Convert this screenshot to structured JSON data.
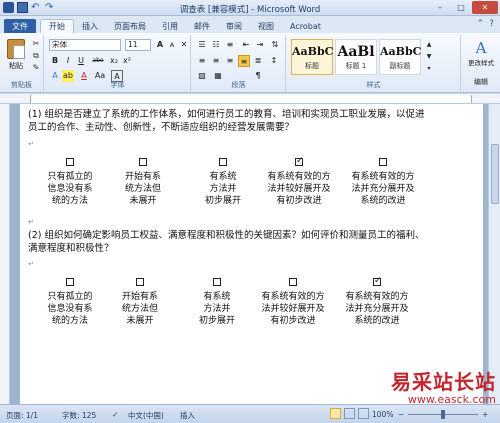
{
  "window": {
    "title": "调查表 [兼容模式] - Microsoft Word",
    "controls": {
      "minimize": "–",
      "maximize": "□",
      "close": "✕"
    }
  },
  "tabs": [
    "文件",
    "开始",
    "插入",
    "页面布局",
    "引用",
    "邮件",
    "审阅",
    "视图",
    "Acrobat"
  ],
  "ribbon": {
    "clipboard": {
      "paste_label": "粘贴",
      "group_label": "剪贴板"
    },
    "font": {
      "name": "宋体",
      "size": "11",
      "group_label": "字体",
      "buttons": [
        "B",
        "I",
        "U",
        "abe",
        "x₂",
        "x²",
        "A",
        "A",
        "Aa",
        "A"
      ]
    },
    "paragraph": {
      "group_label": "段落"
    },
    "styles": {
      "group_label": "样式",
      "items": [
        {
          "sample": "AaBbC",
          "name": "标题"
        },
        {
          "sample": "AaBl",
          "name": "标题 1"
        },
        {
          "sample": "AaBbC",
          "name": "副标题"
        }
      ],
      "change_styles": "更改样式",
      "edit_label": "编辑"
    }
  },
  "document": {
    "q1": "(1) 组织是否建立了系统的工作体系，如何进行员工的教育、培训和实现员工职业发展，以促进员工的合作、主动性、创新性，不断适应组织的经营发展需要？",
    "q1_options": [
      {
        "lines": [
          "只有孤立的",
          "信息没有系",
          "统的方法"
        ],
        "checked": false
      },
      {
        "lines": [
          "开始有系",
          "统方法但",
          "未展开"
        ],
        "checked": false
      },
      {
        "lines": [
          "有系统",
          "方法并",
          "初步展开"
        ],
        "checked": false
      },
      {
        "lines": [
          "有系统有效的方",
          "法并较好展开及",
          "有初步改进"
        ],
        "checked": true
      },
      {
        "lines": [
          "有系统有效的方",
          "法并充分展开及",
          "系统的改进"
        ],
        "checked": false
      }
    ],
    "q2": "(2) 组织如何确定影响员工权益、满意程度和积极性的关键因素？如何评价和测量员工的福利、满意程度和积极性？",
    "q2_options": [
      {
        "lines": [
          "只有孤立的",
          "信息没有系",
          "统的方法"
        ],
        "checked": false
      },
      {
        "lines": [
          "开始有系",
          "统方法但",
          "未展开"
        ],
        "checked": false
      },
      {
        "lines": [
          "有系统",
          "方法并",
          "初步展开"
        ],
        "checked": false
      },
      {
        "lines": [
          "有系统有效的方",
          "法并较好展开及",
          "有初步改进"
        ],
        "checked": false
      },
      {
        "lines": [
          "有系统有效的方",
          "法并充分展开及",
          "系统的改进"
        ],
        "checked": true
      }
    ]
  },
  "statusbar": {
    "page": "页面: 1/1",
    "words": "字数: 125",
    "language": "中文(中国)",
    "mode": "插入",
    "zoom": "100%"
  },
  "watermark": {
    "text": "易采站长站",
    "url": "www.easck.com"
  },
  "colors": {
    "file_tab": "#2f5fa4",
    "close_button": "#c84a3d",
    "watermark": "#c3262f"
  }
}
